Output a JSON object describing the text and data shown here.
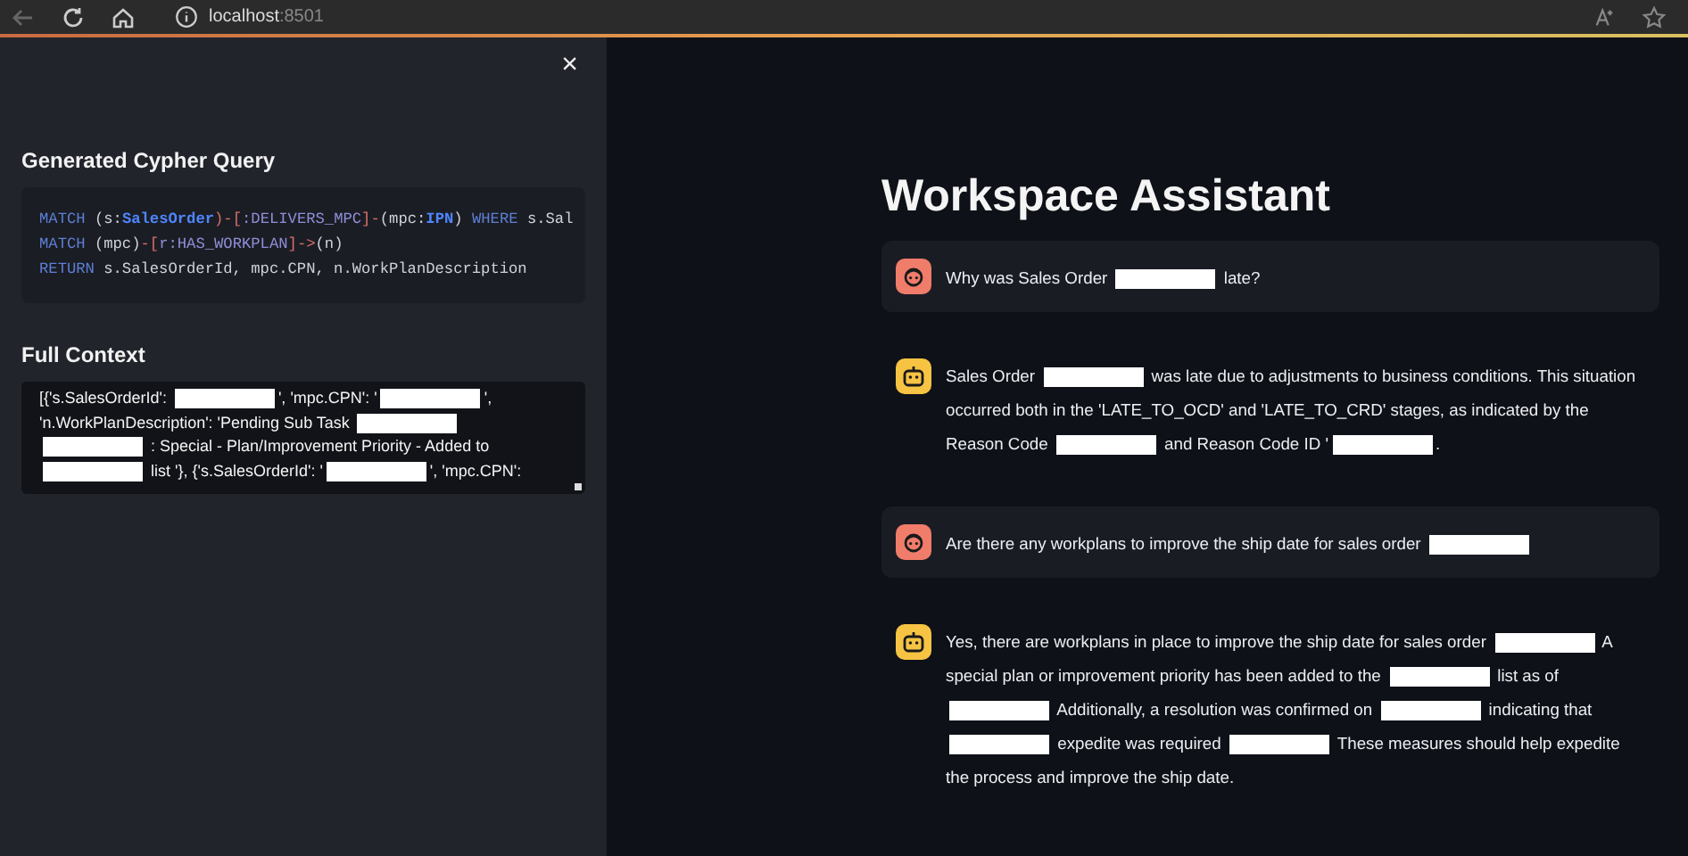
{
  "browser": {
    "host": "localhost",
    "port": ":8501"
  },
  "sidebar": {
    "close": "×",
    "query_heading": "Generated Cypher Query",
    "query_lines": [
      [
        {
          "kind": "kw",
          "text": "MATCH"
        },
        {
          "kind": "plain",
          "text": " (s:"
        },
        {
          "kind": "label",
          "text": "SalesOrder"
        },
        {
          "kind": "punct",
          "text": ")-["
        },
        {
          "kind": "rel",
          "text": ":DELIVERS_MPC"
        },
        {
          "kind": "punct",
          "text": "]-"
        },
        {
          "kind": "plain",
          "text": "(mpc:"
        },
        {
          "kind": "label",
          "text": "IPN"
        },
        {
          "kind": "plain",
          "text": ") "
        },
        {
          "kind": "kw",
          "text": "WHERE"
        },
        {
          "kind": "plain",
          "text": " s.Sal"
        }
      ],
      [
        {
          "kind": "kw",
          "text": "MATCH"
        },
        {
          "kind": "plain",
          "text": " (mpc)"
        },
        {
          "kind": "punct",
          "text": "-["
        },
        {
          "kind": "rel",
          "text": "r:HAS_WORKPLAN"
        },
        {
          "kind": "punct",
          "text": "]->"
        },
        {
          "kind": "plain",
          "text": "(n)"
        }
      ],
      [
        {
          "kind": "kw",
          "text": "RETURN"
        },
        {
          "kind": "plain",
          "text": " s.SalesOrderId, mpc.CPN, n.WorkPlanDescription"
        }
      ]
    ],
    "context_heading": "Full Context",
    "context": [
      {
        "kind": "text",
        "text": "[{'s.SalesOrderId': "
      },
      {
        "kind": "redacted"
      },
      {
        "kind": "text",
        "text": "', 'mpc.CPN': '"
      },
      {
        "kind": "redacted"
      },
      {
        "kind": "text",
        "text": "', 'n.WorkPlanDescription': 'Pending Sub Task "
      },
      {
        "kind": "redacted"
      },
      {
        "kind": "redacted"
      },
      {
        "kind": "text",
        "text": " : Special - Plan/Improvement Priority - Added to "
      },
      {
        "kind": "redacted"
      },
      {
        "kind": "text",
        "text": " list '}, {'s.SalesOrderId': '"
      },
      {
        "kind": "redacted"
      },
      {
        "kind": "text",
        "text": "', 'mpc.CPN':"
      }
    ]
  },
  "title": "Workspace Assistant",
  "messages": [
    {
      "kind": "user",
      "segments": [
        {
          "kind": "text",
          "text": "Why was Sales Order "
        },
        {
          "kind": "redacted"
        },
        {
          "kind": "text",
          "text": " late?"
        }
      ]
    },
    {
      "kind": "assistant",
      "segments": [
        {
          "kind": "text",
          "text": "Sales Order "
        },
        {
          "kind": "redacted"
        },
        {
          "kind": "text",
          "text": " was late due to adjustments to business conditions. This situation occurred both in the 'LATE_TO_OCD' and 'LATE_TO_CRD' stages, as indicated by the Reason Code "
        },
        {
          "kind": "redacted"
        },
        {
          "kind": "text",
          "text": " and Reason Code ID '"
        },
        {
          "kind": "redacted"
        },
        {
          "kind": "text",
          "text": "."
        }
      ]
    },
    {
      "kind": "user",
      "segments": [
        {
          "kind": "text",
          "text": "Are there any workplans to improve the ship date for sales order "
        },
        {
          "kind": "redacted"
        }
      ]
    },
    {
      "kind": "assistant",
      "segments": [
        {
          "kind": "text",
          "text": "Yes, there are workplans in place to improve the ship date for sales order "
        },
        {
          "kind": "redacted"
        },
        {
          "kind": "text",
          "text": " A special plan or improvement priority has been added to the "
        },
        {
          "kind": "redacted"
        },
        {
          "kind": "text",
          "text": " list as of "
        },
        {
          "kind": "redacted"
        },
        {
          "kind": "text",
          "text": " Additionally, a resolution was confirmed on "
        },
        {
          "kind": "redacted"
        },
        {
          "kind": "text",
          "text": " indicating that "
        },
        {
          "kind": "redacted"
        },
        {
          "kind": "text",
          "text": " expedite was required "
        },
        {
          "kind": "redacted"
        },
        {
          "kind": "text",
          "text": " These measures should help expedite the process and improve the ship date."
        }
      ]
    }
  ]
}
